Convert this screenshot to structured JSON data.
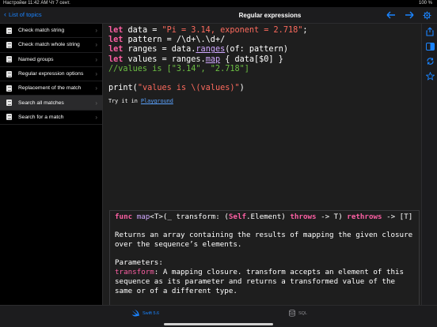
{
  "status": {
    "left": "Настройки 11:42 AM Чт 7 сент.",
    "right": "100 %"
  },
  "topbar": {
    "back_label": "List of topics",
    "title": "Regular expressions"
  },
  "sidebar": {
    "items": [
      {
        "label": "Check match string"
      },
      {
        "label": "Check match whole string"
      },
      {
        "label": "Named groups"
      },
      {
        "label": "Regular expression options"
      },
      {
        "label": "Replacement of the match"
      },
      {
        "label": "Search all matches"
      },
      {
        "label": "Search for a match"
      }
    ],
    "selected_index": 5
  },
  "code": {
    "l1": {
      "kw": "let",
      "a": " data = ",
      "s": "\"Pi = 3.14, exponent = 2.718\"",
      "b": ";"
    },
    "l2": {
      "kw": "let",
      "a": " pattern = /\\d+\\.\\d+/"
    },
    "l3": {
      "kw": "let",
      "a": " ranges = data.",
      "fn": "ranges",
      "b": "(of: pattern)"
    },
    "l4": {
      "kw": "let",
      "a": " values = ranges.",
      "fn": "map",
      "b": " { data[$0] }"
    },
    "l5": {
      "comment": "//values is [\"3.14\", \"2.718\"]"
    },
    "l7": {
      "a": "print(",
      "s": "\"values is \\(values)\"",
      "b": ")"
    }
  },
  "tryit": {
    "prefix": "Try it in ",
    "link": "Playground"
  },
  "doc": {
    "sig_func": "func",
    "sig_name": "map",
    "sig_a": "<T>(_ transform: (",
    "sig_self": "Self",
    "sig_b": ".Element) ",
    "sig_throws": "throws",
    "sig_c": " -> T) ",
    "sig_rethrows": "rethrows",
    "sig_d": " -> [T]",
    "summary": "Returns an array containing the results of mapping the given closure over the sequence’s elements.",
    "params_title": "Parameters:",
    "param_name": "transform",
    "param_desc": ": A mapping closure. transform accepts an element of this sequence as its parameter and returns a transformed value of the same or of a different type."
  },
  "tabs": [
    {
      "label": "Swift 5.6"
    },
    {
      "label": "SQL"
    }
  ],
  "colors": {
    "accent": "#1a84ff",
    "keyword": "#fc5fa3",
    "string": "#fc6a5d",
    "comment": "#6cbf43"
  }
}
